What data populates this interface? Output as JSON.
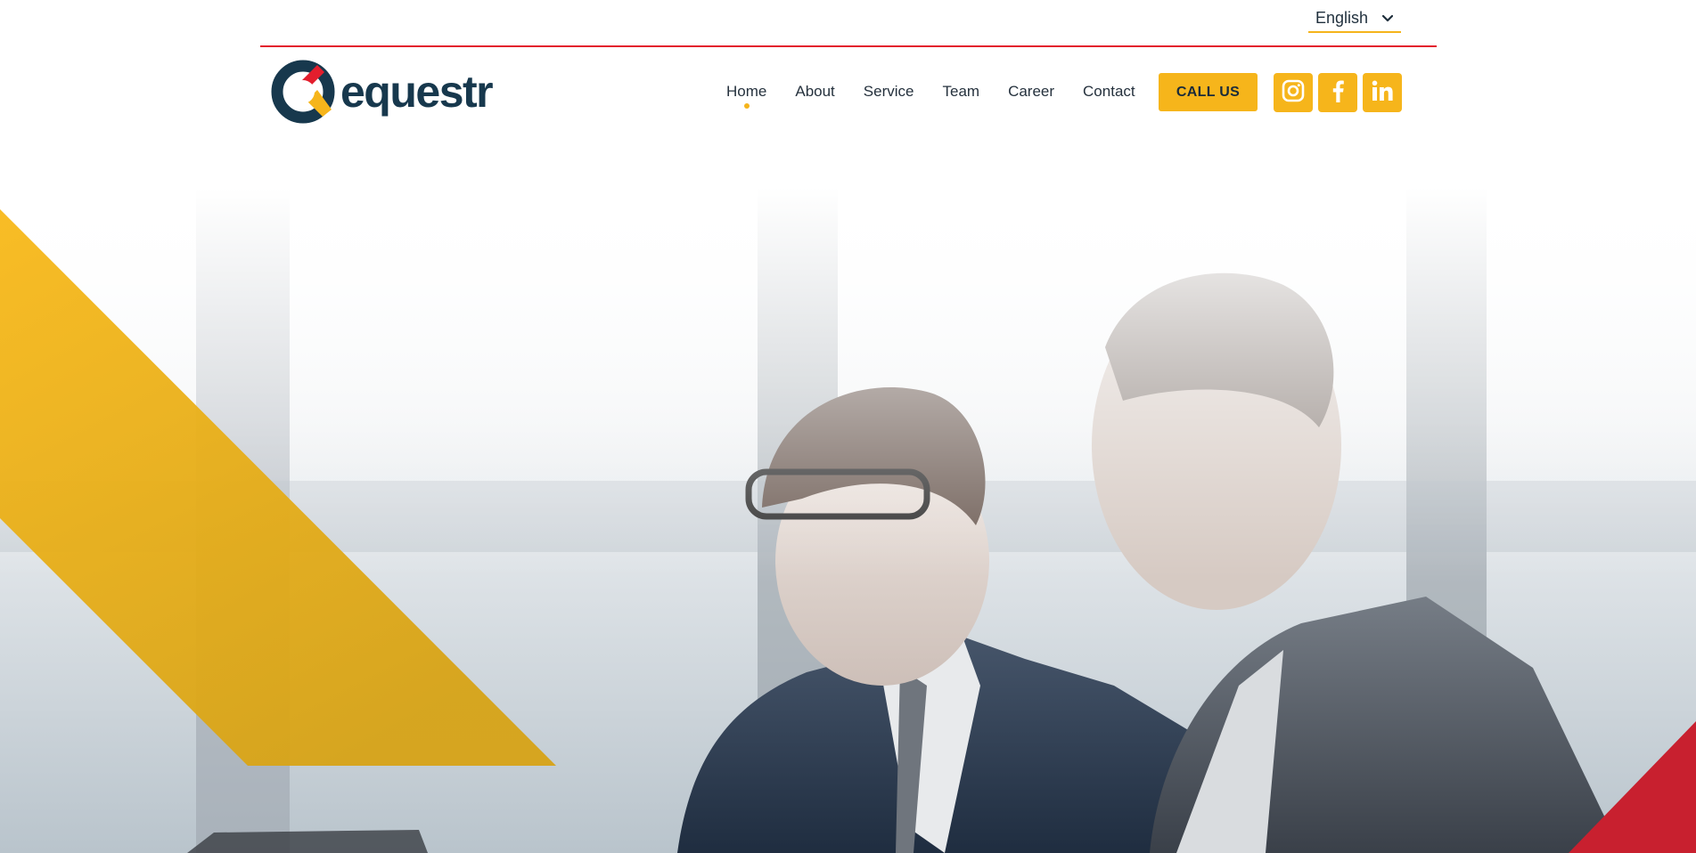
{
  "language_select": {
    "value": "English"
  },
  "logo": {
    "text": "equestr",
    "icon": "equestr-q-logo-icon"
  },
  "nav": {
    "items": [
      {
        "label": "Home",
        "active": true
      },
      {
        "label": "About",
        "active": false
      },
      {
        "label": "Service",
        "active": false
      },
      {
        "label": "Team",
        "active": false
      },
      {
        "label": "Career",
        "active": false
      },
      {
        "label": "Contact",
        "active": false
      }
    ]
  },
  "call_button": {
    "label": "CALL US"
  },
  "social": [
    {
      "icon": "instagram-icon"
    },
    {
      "icon": "facebook-icon"
    },
    {
      "icon": "linkedin-icon"
    }
  ],
  "hero": {
    "image": "two-businessmen-photo"
  },
  "colors": {
    "brand_yellow": "#f6b51b",
    "brand_red": "#e31e2d",
    "brand_navy": "#17384d",
    "text_dark": "#25313d"
  }
}
